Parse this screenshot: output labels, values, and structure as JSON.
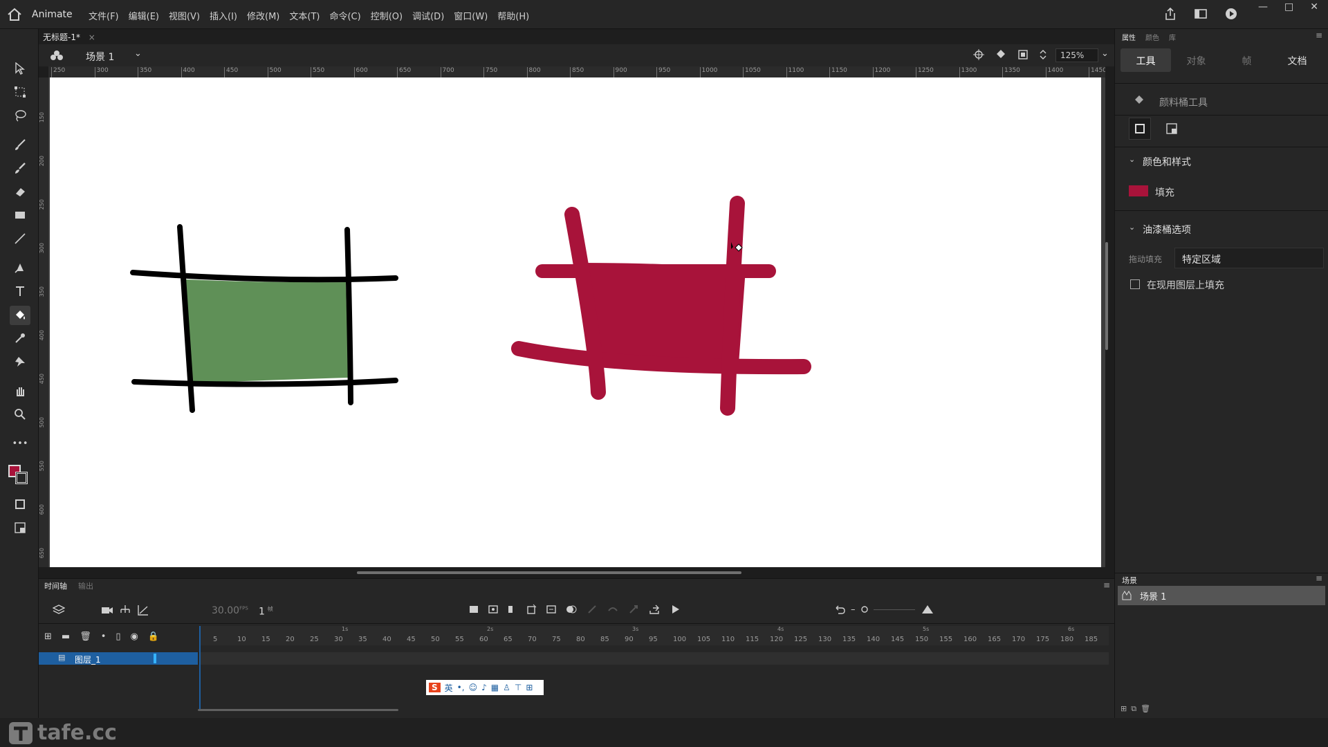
{
  "app": {
    "name": "Animate",
    "menus": [
      "文件(F)",
      "编辑(E)",
      "视图(V)",
      "插入(I)",
      "修改(M)",
      "文本(T)",
      "命令(C)",
      "控制(O)",
      "调试(D)",
      "窗口(W)",
      "帮助(H)"
    ]
  },
  "document_tab": {
    "title": "无标题-1*",
    "close": "×"
  },
  "scene_bar": {
    "scene_name": "场景 1",
    "zoom": "125%"
  },
  "ruler": {
    "top_labels": [
      "250",
      "300",
      "350",
      "400",
      "450",
      "500",
      "550",
      "600",
      "650",
      "700",
      "750",
      "800",
      "850",
      "900",
      "950",
      "1000",
      "1050",
      "1100",
      "1150",
      "1200",
      "1250",
      "1300",
      "1350",
      "1400",
      "1450"
    ],
    "left_labels": [
      "150",
      "200",
      "250",
      "300",
      "350",
      "400",
      "450",
      "500",
      "550",
      "600",
      "650"
    ]
  },
  "properties_panel": {
    "tabs_top": [
      "属性",
      "颜色",
      "库"
    ],
    "tabs": [
      "工具",
      "对象",
      "帧",
      "文档"
    ],
    "active_tab": "工具",
    "tool_name": "颜料桶工具",
    "section_color": "颜色和样式",
    "fill_label": "填充",
    "fill_color": "#a8133a",
    "section_bucket": "油漆桶选项",
    "drag_fill_label": "拖动填充",
    "drag_fill_value": "特定区域",
    "checkbox_label": "在现用图层上填充",
    "checkbox_checked": false
  },
  "scene_panel": {
    "title": "场景",
    "items": [
      "场景 1"
    ]
  },
  "timeline": {
    "tabs": [
      "时间轴",
      "输出"
    ],
    "fps": "30.00",
    "fps_unit": "FPS",
    "current_frame": "1",
    "frame_unit": "帧",
    "layer_name": "图层_1",
    "frame_numbers": [
      "5",
      "10",
      "15",
      "20",
      "25",
      "30",
      "35",
      "40",
      "45",
      "50",
      "55",
      "60",
      "65",
      "70",
      "75",
      "80",
      "85",
      "90",
      "95",
      "100",
      "105",
      "110",
      "115",
      "120",
      "125",
      "130",
      "135",
      "140",
      "145",
      "150",
      "155",
      "160",
      "165",
      "170",
      "175",
      "180",
      "185"
    ],
    "seconds": [
      "1s",
      "2s",
      "3s",
      "4s",
      "5s",
      "6s"
    ]
  },
  "ime_bar": {
    "lang": "英"
  },
  "watermark": "tafe.cc",
  "colors": {
    "green_fill": "#5f9057",
    "red_fill": "#a8133a",
    "stroke": "#000000",
    "accent_blue": "#1e5fa0"
  },
  "icons": [
    "home-icon",
    "share-icon",
    "layout-icon",
    "play-icon",
    "minimize-icon",
    "maximize-icon",
    "close-icon",
    "selection-tool-icon",
    "free-transform-icon",
    "lasso-icon",
    "brush-icon",
    "paint-brush-icon",
    "eraser-icon",
    "rectangle-icon",
    "line-icon",
    "pen-icon",
    "text-icon",
    "paint-bucket-icon",
    "eyedropper-icon",
    "pin-icon",
    "hand-icon",
    "zoom-icon",
    "more-icon"
  ]
}
